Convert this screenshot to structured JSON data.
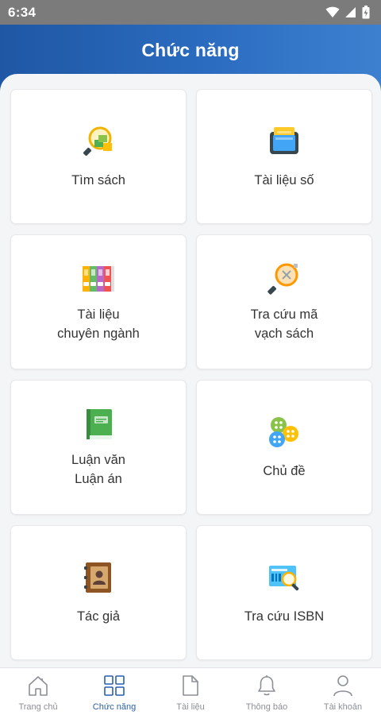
{
  "status_bar": {
    "time": "6:34"
  },
  "header": {
    "title": "Chức năng"
  },
  "cards": [
    {
      "label": "Tìm sách",
      "icon": "book-search-icon"
    },
    {
      "label": "Tài liệu số",
      "icon": "ebook-reader-icon"
    },
    {
      "label": "Tài liệu\nchuyên ngành",
      "icon": "binders-icon"
    },
    {
      "label": "Tra cứu mã\nvạch sách",
      "icon": "barcode-search-icon"
    },
    {
      "label": "Luận văn\nLuận án",
      "icon": "thesis-book-icon"
    },
    {
      "label": "Chủ đề",
      "icon": "topic-balls-icon"
    },
    {
      "label": "Tác giả",
      "icon": "author-contact-book-icon"
    },
    {
      "label": "Tra cứu ISBN",
      "icon": "isbn-lookup-icon"
    }
  ],
  "tabbar": {
    "active_tab": "Chức năng",
    "accent_color": "#2a5fb0",
    "tabs": [
      {
        "label": "Trang chủ",
        "icon": "home-icon"
      },
      {
        "label": "Chức năng",
        "icon": "grid-icon"
      },
      {
        "label": "Tài liệu",
        "icon": "document-icon"
      },
      {
        "label": "Thông báo",
        "icon": "bell-icon"
      },
      {
        "label": "Tài khoản",
        "icon": "account-icon"
      }
    ]
  }
}
